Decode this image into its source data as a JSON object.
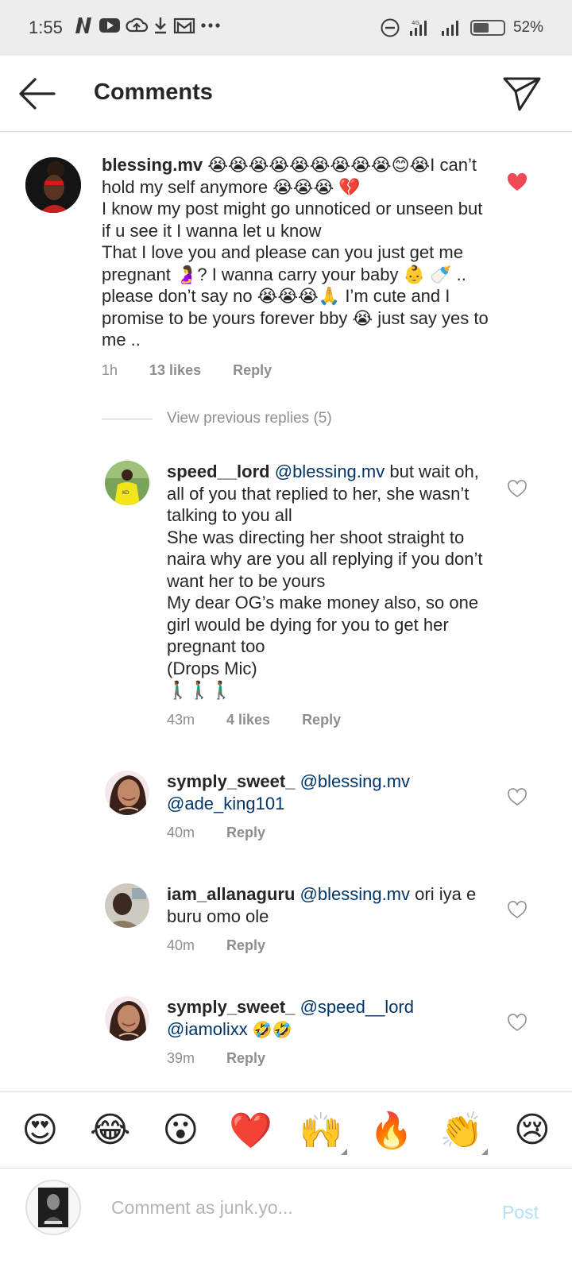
{
  "status_bar": {
    "time": "1:55",
    "battery": "52%",
    "battery_level": 0.52
  },
  "header": {
    "title": "Comments"
  },
  "main_comment": {
    "username": "blessing.mv",
    "text_parts": [
      "😭😭😭😭😭😭😭😭😭😊😭I can’t hold my self anymore 😭😭😭 💔",
      "I know my post might go unnoticed or unseen but if u see it I wanna let u know",
      "That I love you and please can you just get me pregnant 🤰? I wanna carry your baby 👶 🍼 .. please don’t say no 😭😭😭🙏 I’m cute  and I promise to be yours forever bby 😭 just say yes to me .."
    ],
    "time": "1h",
    "likes": "13 likes",
    "reply": "Reply",
    "liked": true,
    "like_color": "#ed4956"
  },
  "view_previous": "View previous replies (5)",
  "replies": [
    {
      "username": "speed__lord",
      "mention": "@blessing.mv",
      "text": "but wait oh, all of you that replied to her, she wasn’t talking to you all\nShe was directing her shoot straight to naira why are you all replying if you don’t want her to be yours\nMy dear OG’s make money also, so one girl would be dying for you to get her pregnant too\n(Drops Mic)\n🚶🏾‍♂️🚶🏾‍♂️🚶🏾‍♂️",
      "time": "43m",
      "likes": "4 likes",
      "reply": "Reply"
    },
    {
      "username": "symply_sweet_",
      "mention": "@blessing.mv",
      "mention2": "@ade_king101",
      "text": "",
      "time": "40m",
      "reply": "Reply"
    },
    {
      "username": "iam_allanaguru",
      "mention": "@blessing.mv",
      "text": "ori iya e buru omo ole",
      "time": "40m",
      "reply": "Reply"
    },
    {
      "username": "symply_sweet_",
      "mention": "@speed__lord",
      "mention2": "@iamolixx",
      "text": "🤣🤣",
      "time": "39m",
      "reply": "Reply"
    }
  ],
  "emoji_bar": [
    "😍",
    "😂",
    "😮",
    "❤️",
    "🙌",
    "🔥",
    "👏",
    "😢"
  ],
  "composer": {
    "placeholder": "Comment as junk.yo...",
    "post_label": "Post"
  },
  "colors": {
    "mention": "#003569",
    "meta_gray": "#8e8e8e",
    "post_disabled": "#b2dffc",
    "heart_red": "#ed4956"
  }
}
